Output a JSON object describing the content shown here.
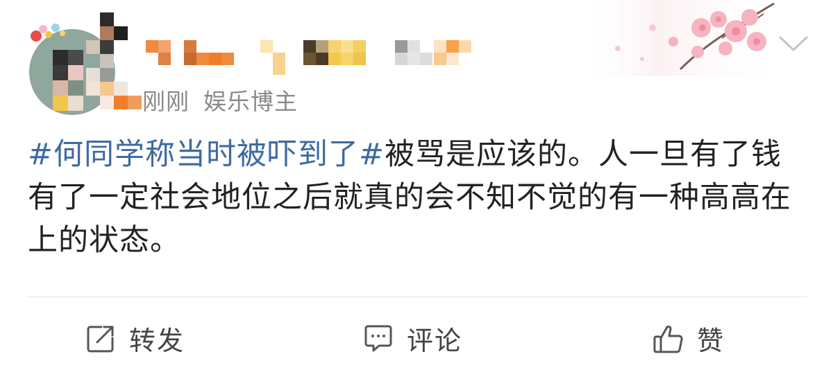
{
  "post": {
    "time": "刚刚",
    "author_badge": "娱乐博主",
    "hashtag": "#何同学称当时被吓到了#",
    "text": "被骂是应该的。人一旦有了钱有了一定社会地位之后就真的会不知不觉的有一种高高在上的状态。"
  },
  "actions": {
    "repost_label": "转发",
    "comment_label": "评论",
    "like_label": "赞"
  },
  "colors": {
    "hashtag": "#3e6aa1",
    "meta_text": "#8a8a8a",
    "body_text": "#222222",
    "icon": "#444444"
  },
  "icons": {
    "repost": "repost-icon",
    "comment": "comment-icon",
    "like": "thumbs-up-icon",
    "more": "chevron-down-icon"
  }
}
